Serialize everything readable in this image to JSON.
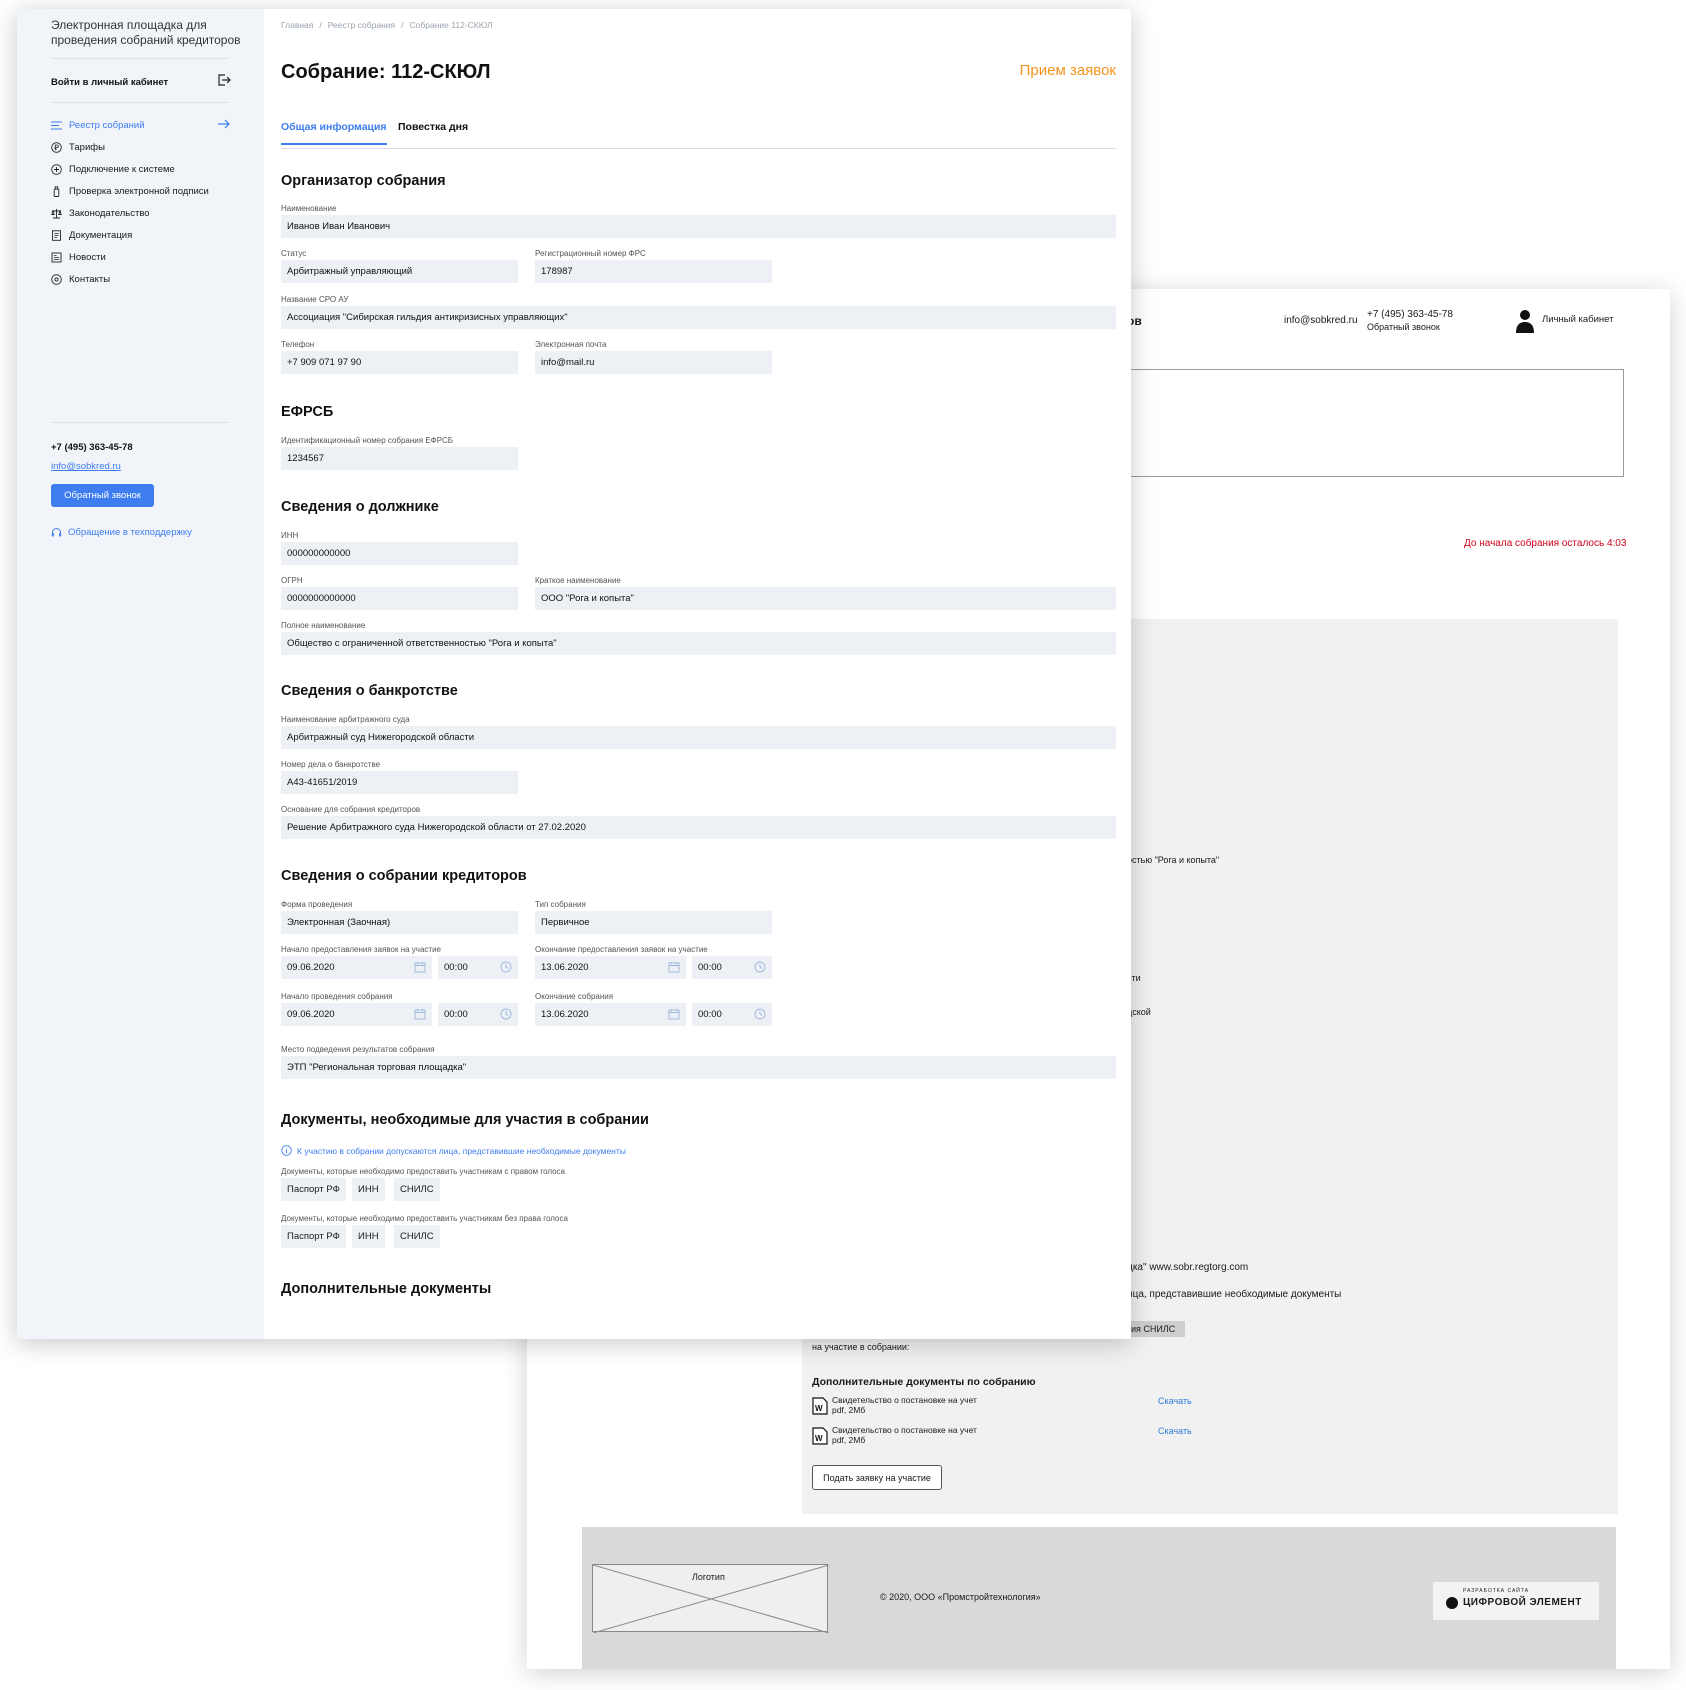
{
  "back_window": {
    "header_fragment": "ов",
    "email": "info@sobkred.ru",
    "phone": "+7 (495) 363-45-78",
    "callback": "Обратный звонок",
    "cabinet": "Личный кабинет",
    "timer": "До начала собрания осталось 4:03",
    "fragments": [
      "остью \"Рога и копыта\"",
      "сти",
      "дской",
      "дка\" www.sobr.regtorg.com",
      "ица, представившие необходимые документы",
      "на участие в собрании:"
    ],
    "chip_fragment": "ия СНИЛС",
    "extra_docs_title": "Дополнительные документы по собранию",
    "docs": [
      {
        "name": "Свидетельство о постановке на учет",
        "meta": "pdf, 2Мб",
        "action": "Скачать"
      },
      {
        "name": "Свидетельство о постановке на учет",
        "meta": "pdf, 2Мб",
        "action": "Скачать"
      }
    ],
    "apply_button": "Подать заявку на участие",
    "footer_logo": "Логотип",
    "copyright": "© 2020, ООО «Промстройтехнология»",
    "brand_small": "РАЗРАБОТКА САЙТА",
    "brand_large": "ЦИФРОВОЙ ЭЛЕМЕНТ"
  },
  "sidebar": {
    "brand": "Электронная площадка для проведения собраний кредиторов",
    "login": "Войти в личный кабинет",
    "nav": [
      {
        "label": "Реестр собраний",
        "icon": "list-icon",
        "active": true
      },
      {
        "label": "Тарифы",
        "icon": "ruble-icon"
      },
      {
        "label": "Подключение к системе",
        "icon": "plus-circle-icon"
      },
      {
        "label": "Проверка электронной подписи",
        "icon": "token-icon"
      },
      {
        "label": "Законодательство",
        "icon": "scales-icon"
      },
      {
        "label": "Документация",
        "icon": "document-icon"
      },
      {
        "label": "Новости",
        "icon": "news-icon"
      },
      {
        "label": "Контакты",
        "icon": "location-icon"
      }
    ],
    "phone": "+7 (495) 363-45-78",
    "email": "info@sobkred.ru",
    "callback": "Обратный звонок",
    "support": "Обращение в техподдержку"
  },
  "breadcrumb": [
    "Главная",
    "Реестр собрания",
    "Собрание 112-СКЮЛ"
  ],
  "title": "Собрание: 112-СКЮЛ",
  "status": "Прием заявок",
  "tabs": [
    "Общая информация",
    "Повестка дня"
  ],
  "organizer": {
    "heading": "Организатор собрания",
    "name_label": "Наименование",
    "name": "Иванов Иван Иванович",
    "status_label": "Статус",
    "status": "Арбитражный управляющий",
    "reg_label": "Регистрационный номер ФРС",
    "reg": "178987",
    "sro_label": "Название СРО АУ",
    "sro": "Ассоциация \"Сибирская гильдия антикризисных управляющих\"",
    "phone_label": "Телефон",
    "phone": "+7 909 071 97 90",
    "email_label": "Электронная почта",
    "email": "info@mail.ru"
  },
  "efrsb": {
    "heading": "ЕФРСБ",
    "id_label": "Идентификационный номер собрания ЕФРСБ",
    "id": "1234567"
  },
  "debtor": {
    "heading": "Сведения о должнике",
    "inn_label": "ИНН",
    "inn": "000000000000",
    "ogrn_label": "ОГРН",
    "ogrn": "0000000000000",
    "short_label": "Краткое наименование",
    "short": "ООО \"Рога и копыта\"",
    "full_label": "Полное наименование",
    "full": "Общество с ограниченной ответственностью \"Рога и копыта\""
  },
  "bankruptcy": {
    "heading": "Сведения о банкротстве",
    "court_label": "Наименование арбитражного суда",
    "court": "Арбитражный суд Нижегородской области",
    "case_label": "Номер дела о банкротстве",
    "case": "А43-41651/2019",
    "basis_label": "Основание для собрания кредиторов",
    "basis": "Решение Арбитражного суда Нижегородской области от 27.02.2020"
  },
  "meeting": {
    "heading": "Сведения о собрании кредиторов",
    "form_label": "Форма проведения",
    "form": "Электронная (Заочная)",
    "type_label": "Тип собрания",
    "type": "Первичное",
    "apps_start_label": "Начало предоставления заявок на участие",
    "apps_start_date": "09.06.2020",
    "apps_start_time": "00:00",
    "apps_end_label": "Окончание предоставления заявок на участие",
    "apps_end_date": "13.06.2020",
    "apps_end_time": "00:00",
    "start_label": "Начало проведения собрания",
    "start_date": "09.06.2020",
    "start_time": "00:00",
    "end_label": "Окончание собрания",
    "end_date": "13.06.2020",
    "end_time": "00:00",
    "place_label": "Место подведения результатов собрания",
    "place": "ЭТП \"Региональная торговая площадка\""
  },
  "documents": {
    "heading": "Документы, необходимые для участия в собрании",
    "note": "К участию в собрании допускаются лица, представившие необходимые документы",
    "voting_label": "Документы, которые необходимо предоставить участникам с правом голоса",
    "voting": [
      "Паспорт РФ",
      "ИНН",
      "СНИЛС"
    ],
    "nonvoting_label": "Документы, которые необходимо предоставить участникам без права голоса",
    "nonvoting": [
      "Паспорт РФ",
      "ИНН",
      "СНИЛС"
    ]
  },
  "extra_heading": "Дополнительные документы",
  "colors": {
    "accent": "#3d7df0",
    "status": "#f7941d",
    "field_bg": "#edf1f6",
    "sidebar_bg": "#f1f4f8",
    "timer": "#d0021b"
  }
}
